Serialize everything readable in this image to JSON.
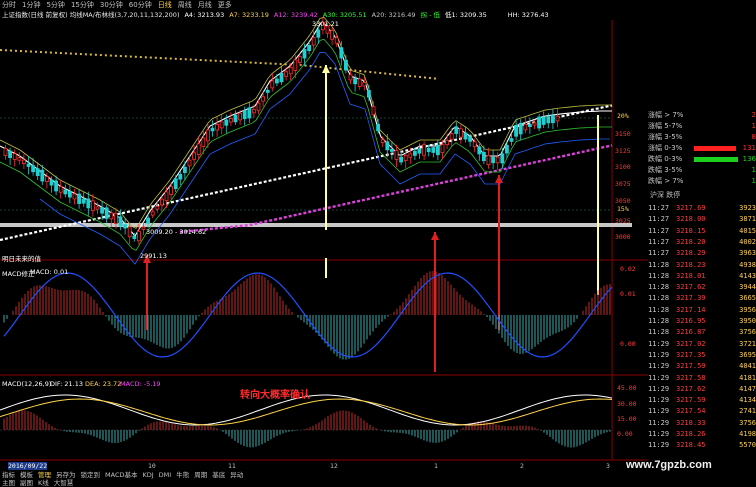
{
  "tabs": [
    "分时",
    "1分钟",
    "5分钟",
    "15分钟",
    "30分钟",
    "60分钟",
    "日线",
    "周线",
    "月线",
    "更多"
  ],
  "active_tab": "日线",
  "info": {
    "name": "上证指数(日线 前复权) 均线MA/布林线(3,7,20,11,132,200)",
    "a4": "A4: 3213.93",
    "a7": "A7: 3233.19",
    "a12": "A12: 3239.42",
    "a30": "A30: 3205.51",
    "a20": "A20: 3216.49",
    "ellipsis": "拐 - 低",
    "low": "低1: 3209.35",
    "hh": "HH: 3276.43"
  },
  "price_axis": [
    "3150",
    "3125",
    "3100",
    "3075",
    "3050",
    "3025",
    "3000"
  ],
  "pct_labels": {
    "top": "20%",
    "bottom": "15%"
  },
  "annotations": {
    "high": "3301.21",
    "low_range": "3009.20 - 3014.62",
    "low_point": "2991.13",
    "future": "明日未来的值",
    "hint": "转向大概率确认"
  },
  "macd_adj": {
    "title": "MACD修正",
    "label": "MACD: 0.01",
    "axis": [
      "0.02",
      "0.01",
      "0.00"
    ]
  },
  "macd": {
    "label": "MACD(12,26,9)",
    "dif": "DIF: 21.13",
    "dea": "DEA: 23.72",
    "macd": "MACD: -5.19",
    "axis": [
      "45.00",
      "30.00",
      "15.00",
      "0.00"
    ]
  },
  "date_axis": {
    "start": "2016/09/22",
    "marks": [
      "10",
      "11",
      "12",
      "1",
      "2",
      "3"
    ]
  },
  "right_panel": {
    "stats": [
      {
        "label": "涨幅 > 7%",
        "value": "2",
        "bar": 0
      },
      {
        "label": "涨幅 5-7%",
        "value": "1",
        "bar": 0
      },
      {
        "label": "涨幅 3-5%",
        "value": "8",
        "bar": 0
      },
      {
        "label": "涨幅 0-3%",
        "value": "131",
        "bar": 0.95,
        "color": "#ff2020"
      },
      {
        "label": "跌幅 0-3%",
        "value": "136",
        "bar": 1.0,
        "color": "#1ed01e"
      },
      {
        "label": "跌幅 3-5%",
        "value": "1",
        "bar": 0
      },
      {
        "label": "跌幅 > 7%",
        "value": "1",
        "bar": 0
      }
    ],
    "footer": "沪深 跌停",
    "ticks": [
      {
        "time": "11:27",
        "price": "3217.69",
        "vol": "3923"
      },
      {
        "time": "11:27",
        "price": "3218.00",
        "vol": "3871"
      },
      {
        "time": "11:27",
        "price": "3218.15",
        "vol": "4015"
      },
      {
        "time": "11:27",
        "price": "3218.20",
        "vol": "4002"
      },
      {
        "time": "11:27",
        "price": "3218.29",
        "vol": "3963"
      },
      {
        "time": "11:28",
        "price": "3218.23",
        "vol": "4938"
      },
      {
        "time": "11:28",
        "price": "3218.01",
        "vol": "4143"
      },
      {
        "time": "11:28",
        "price": "3217.62",
        "vol": "3944"
      },
      {
        "time": "11:28",
        "price": "3217.39",
        "vol": "3665"
      },
      {
        "time": "11:28",
        "price": "3217.14",
        "vol": "3956"
      },
      {
        "time": "11:28",
        "price": "3216.95",
        "vol": "3950"
      },
      {
        "time": "11:28",
        "price": "3216.87",
        "vol": "3756"
      },
      {
        "time": "11:29",
        "price": "3217.02",
        "vol": "3721"
      },
      {
        "time": "11:29",
        "price": "3217.35",
        "vol": "3695"
      },
      {
        "time": "11:29",
        "price": "3217.59",
        "vol": "4041"
      },
      {
        "time": "11:29",
        "price": "3217.58",
        "vol": "4181"
      },
      {
        "time": "11:29",
        "price": "3217.62",
        "vol": "4147"
      },
      {
        "time": "11:29",
        "price": "3217.59",
        "vol": "4134"
      },
      {
        "time": "11:29",
        "price": "3217.54",
        "vol": "2741"
      },
      {
        "time": "11:29",
        "price": "3218.33",
        "vol": "3756"
      },
      {
        "time": "11:29",
        "price": "3218.26",
        "vol": "4198"
      },
      {
        "time": "11:29",
        "price": "3218.45",
        "vol": "5570"
      }
    ]
  },
  "bottom": {
    "row1": [
      "指标",
      "模板",
      "管理",
      "另存为",
      "锁定到",
      "MACD基本",
      "KDJ",
      "DMI",
      "牛熊",
      "周期",
      "基底",
      "异动"
    ],
    "row2": [
      "主图",
      "副图",
      "K线",
      "大智慧"
    ]
  },
  "watermark": "www.7gpzb.com"
}
